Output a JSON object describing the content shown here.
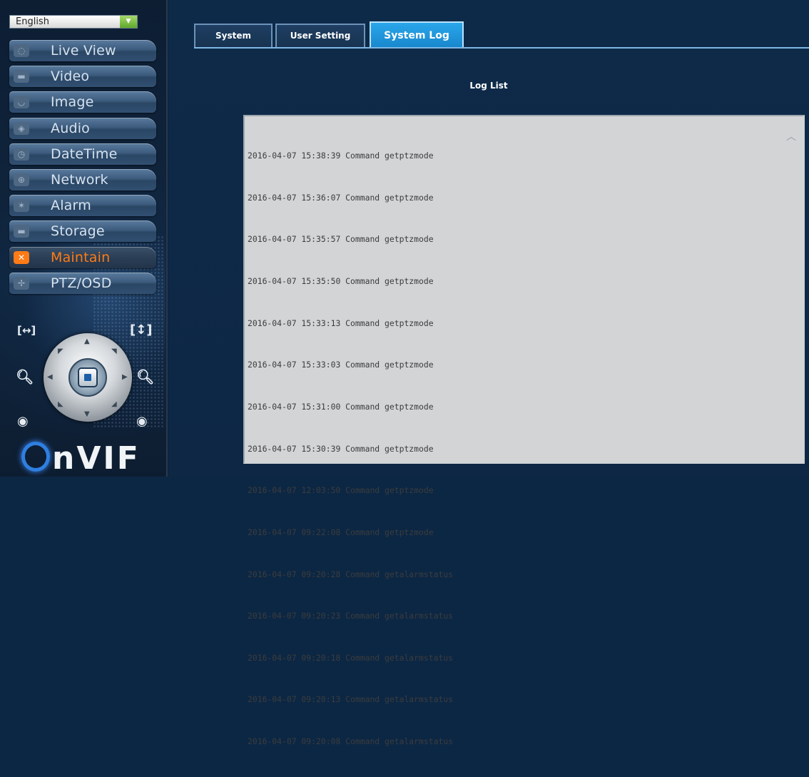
{
  "language": {
    "selected": "English"
  },
  "sidebar": {
    "items": [
      {
        "label": "Live View",
        "icon": "speech-bubble-icon",
        "active": false
      },
      {
        "label": "Video",
        "icon": "camera-icon",
        "active": false
      },
      {
        "label": "Image",
        "icon": "power-icon",
        "active": false
      },
      {
        "label": "Audio",
        "icon": "speaker-icon",
        "active": false
      },
      {
        "label": "DateTime",
        "icon": "clock-icon",
        "active": false
      },
      {
        "label": "Network",
        "icon": "network-icon",
        "active": false
      },
      {
        "label": "Alarm",
        "icon": "alarm-icon",
        "active": false
      },
      {
        "label": "Storage",
        "icon": "storage-icon",
        "active": false
      },
      {
        "label": "Maintain",
        "icon": "wrench-icon",
        "active": true
      },
      {
        "label": "PTZ/OSD",
        "icon": "ptz-icon",
        "active": false
      }
    ],
    "accent_color": "#ff7b16"
  },
  "tabs": [
    {
      "label": "System",
      "active": false
    },
    {
      "label": "User Setting",
      "active": false
    },
    {
      "label": "System Log",
      "active": true
    }
  ],
  "log": {
    "title": "Log List",
    "entries": [
      "2016-04-07 15:38:39 Command getptzmode",
      "2016-04-07 15:36:07 Command getptzmode",
      "2016-04-07 15:35:57 Command getptzmode",
      "2016-04-07 15:35:50 Command getptzmode",
      "2016-04-07 15:33:13 Command getptzmode",
      "2016-04-07 15:33:03 Command getptzmode",
      "2016-04-07 15:31:00 Command getptzmode",
      "2016-04-07 15:30:39 Command getptzmode",
      "2016-04-07 12:03:50 Command getptzmode",
      "2016-04-07 09:22:08 Command getptzmode",
      "2016-04-07 09:20:28 Command getalarmstatus",
      "2016-04-07 09:20:23 Command getalarmstatus",
      "2016-04-07 09:20:18 Command getalarmstatus",
      "2016-04-07 09:20:13 Command getalarmstatus",
      "2016-04-07 09:20:08 Command getalarmstatus"
    ]
  },
  "logo": {
    "text": "nVIF"
  }
}
